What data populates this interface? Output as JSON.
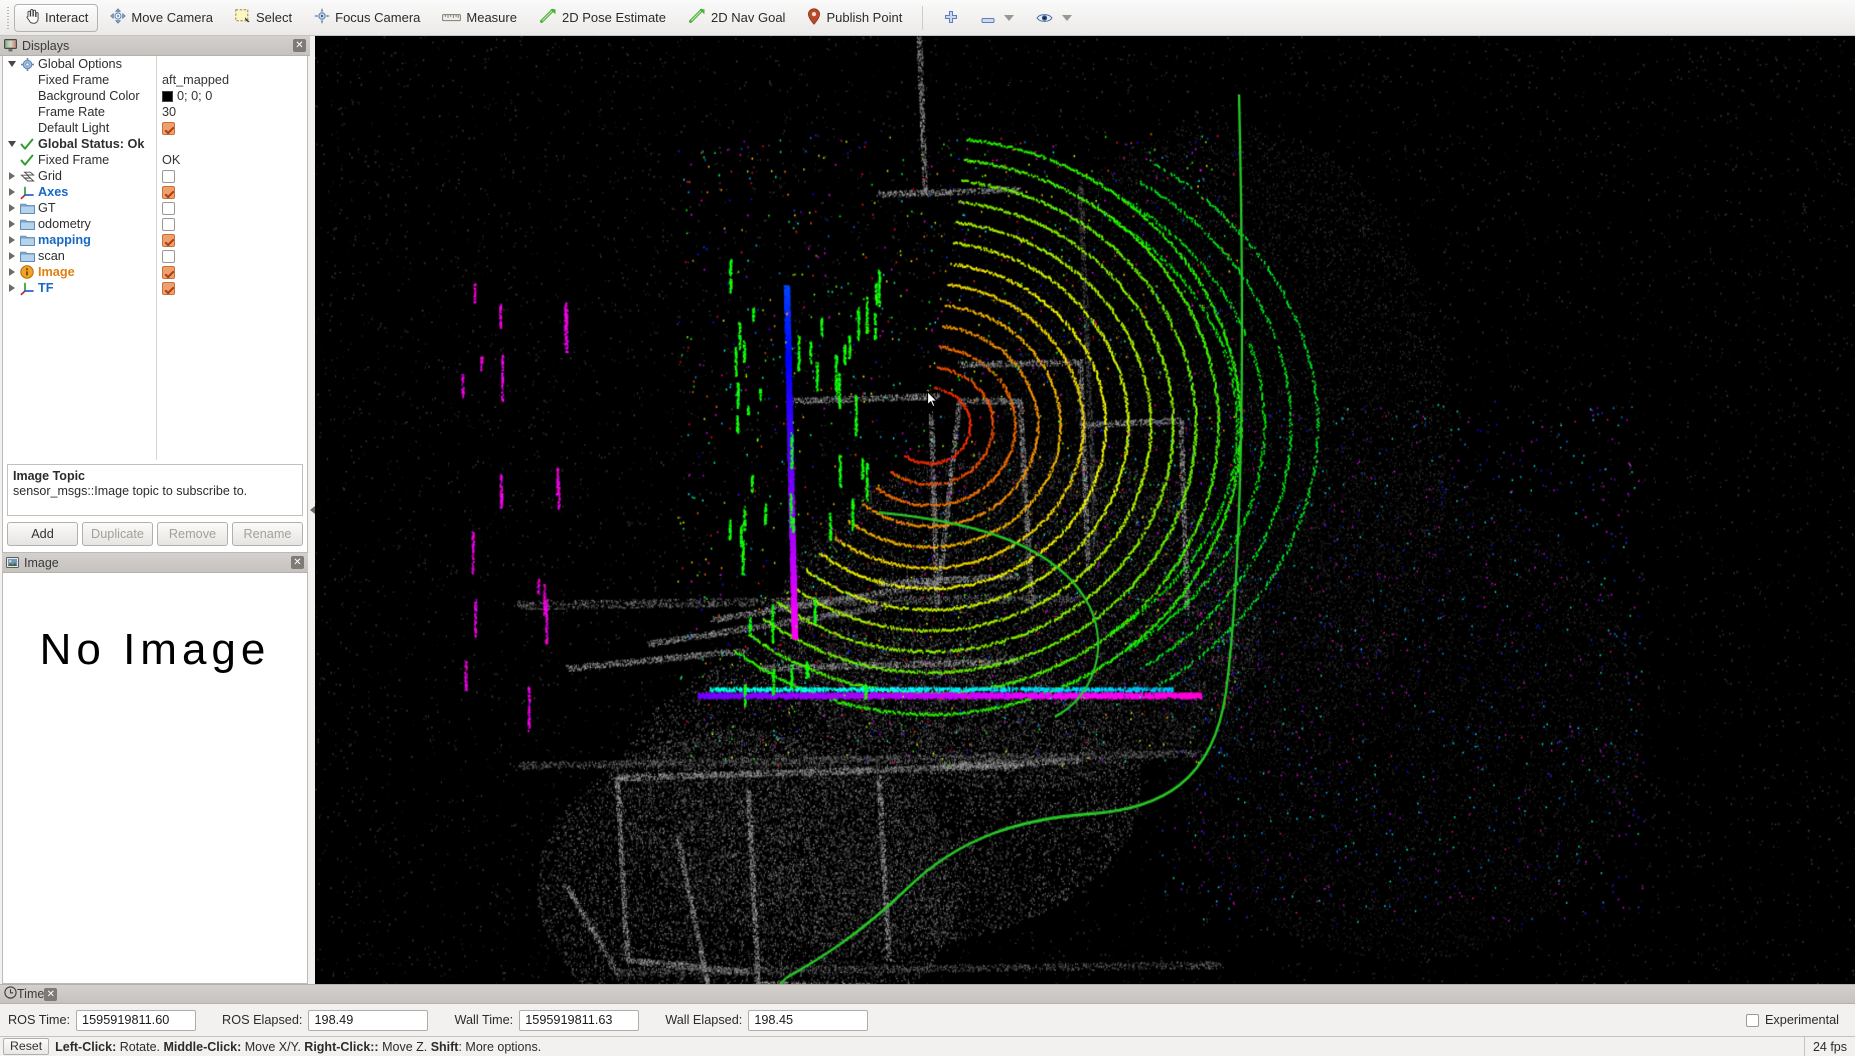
{
  "toolbar": {
    "buttons": [
      {
        "label": "Interact",
        "icon": "hand-icon",
        "active": true
      },
      {
        "label": "Move Camera",
        "icon": "move-camera-icon",
        "active": false
      },
      {
        "label": "Select",
        "icon": "select-icon",
        "active": false
      },
      {
        "label": "Focus Camera",
        "icon": "focus-camera-icon",
        "active": false
      },
      {
        "label": "Measure",
        "icon": "measure-icon",
        "active": false
      },
      {
        "label": "2D Pose Estimate",
        "icon": "green-arrow-icon",
        "active": false
      },
      {
        "label": "2D Nav Goal",
        "icon": "green-arrow-icon",
        "active": false
      },
      {
        "label": "Publish Point",
        "icon": "map-pin-icon",
        "active": false
      }
    ],
    "extra_icons": [
      "plus-icon",
      "minus-icon",
      "eye-icon"
    ]
  },
  "displays_panel": {
    "title": "Displays",
    "title_icon": "monitor-icon",
    "close_label": "✕",
    "tree": [
      {
        "name": "Global Options",
        "value": "",
        "icon": "gear-icon",
        "twisty": "down",
        "indent": 0,
        "style": "plain",
        "check": "none"
      },
      {
        "name": "Fixed Frame",
        "value": "aft_mapped",
        "icon": "none",
        "twisty": "none",
        "indent": 1,
        "style": "plain",
        "check": "none"
      },
      {
        "name": "Background Color",
        "value": "0; 0; 0",
        "icon": "none",
        "twisty": "none",
        "indent": 1,
        "style": "plain",
        "check": "none",
        "swatch": "#000000"
      },
      {
        "name": "Frame Rate",
        "value": "30",
        "icon": "none",
        "twisty": "none",
        "indent": 1,
        "style": "plain",
        "check": "none"
      },
      {
        "name": "Default Light",
        "value": "",
        "icon": "none",
        "twisty": "none",
        "indent": 1,
        "style": "plain",
        "check": "on"
      },
      {
        "name": "Global Status: Ok",
        "value": "",
        "icon": "green-check-icon",
        "twisty": "down",
        "indent": 0,
        "style": "bold",
        "check": "none"
      },
      {
        "name": "Fixed Frame",
        "value": "OK",
        "icon": "green-check-icon",
        "twisty": "none",
        "indent": 1,
        "style": "plain",
        "check": "none"
      },
      {
        "name": "Grid",
        "value": "",
        "icon": "grid-icon",
        "twisty": "right",
        "indent": 0,
        "style": "plain",
        "check": "off"
      },
      {
        "name": "Axes",
        "value": "",
        "icon": "axes-icon",
        "twisty": "right",
        "indent": 0,
        "style": "blue",
        "check": "on"
      },
      {
        "name": "GT",
        "value": "",
        "icon": "folder-icon",
        "twisty": "right",
        "indent": 0,
        "style": "plain",
        "check": "off"
      },
      {
        "name": "odometry",
        "value": "",
        "icon": "folder-icon",
        "twisty": "right",
        "indent": 0,
        "style": "plain",
        "check": "off"
      },
      {
        "name": "mapping",
        "value": "",
        "icon": "folder-icon",
        "twisty": "right",
        "indent": 0,
        "style": "blue",
        "check": "on"
      },
      {
        "name": "scan",
        "value": "",
        "icon": "folder-icon",
        "twisty": "right",
        "indent": 0,
        "style": "plain",
        "check": "off"
      },
      {
        "name": "Image",
        "value": "",
        "icon": "image-display-icon",
        "twisty": "right",
        "indent": 0,
        "style": "orange",
        "check": "on"
      },
      {
        "name": "TF",
        "value": "",
        "icon": "axes-icon",
        "twisty": "right",
        "indent": 0,
        "style": "blue",
        "check": "on"
      }
    ],
    "description": {
      "title": "Image Topic",
      "text": "sensor_msgs::Image topic to subscribe to."
    },
    "buttons": [
      {
        "label": "Add",
        "enabled": true
      },
      {
        "label": "Duplicate",
        "enabled": false
      },
      {
        "label": "Remove",
        "enabled": false
      },
      {
        "label": "Rename",
        "enabled": false
      }
    ]
  },
  "image_panel": {
    "title": "Image",
    "title_icon": "picture-icon",
    "close_label": "✕",
    "placeholder": "No Image"
  },
  "view": {
    "background_color": "#000000",
    "description": "3D point cloud map with rainbow-colored LiDAR scan rings and a green trajectory path"
  },
  "time_panel": {
    "title": "Time",
    "title_icon": "clock-icon",
    "close_label": "✕",
    "fields": [
      {
        "label": "ROS Time:",
        "value": "1595919811.60",
        "width": "w-ros"
      },
      {
        "label": "ROS Elapsed:",
        "value": "198.49",
        "width": "w-ela"
      },
      {
        "label": "Wall Time:",
        "value": "1595919811.63",
        "width": "w-ros"
      },
      {
        "label": "Wall Elapsed:",
        "value": "198.45",
        "width": "w-ela"
      }
    ],
    "experimental_label": "Experimental",
    "experimental_checked": false
  },
  "status_bar": {
    "reset_label": "Reset",
    "hint_parts": [
      {
        "text": "Left-Click:",
        "bold": true
      },
      {
        "text": " Rotate.  ",
        "bold": false
      },
      {
        "text": "Middle-Click:",
        "bold": true
      },
      {
        "text": " Move X/Y.  ",
        "bold": false
      },
      {
        "text": "Right-Click::",
        "bold": true
      },
      {
        "text": " Move Z.  ",
        "bold": false
      },
      {
        "text": "Shift",
        "bold": true
      },
      {
        "text": ": More options.",
        "bold": false
      }
    ],
    "fps": "24 fps"
  }
}
